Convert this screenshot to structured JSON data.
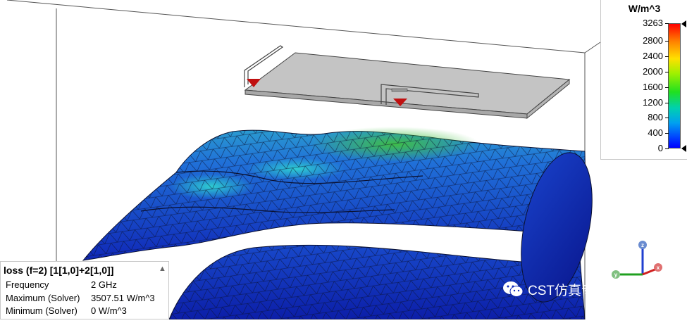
{
  "legend": {
    "unit": "W/m^3",
    "ticks": [
      "3263",
      "2800",
      "2400",
      "2000",
      "1600",
      "1200",
      "800",
      "400",
      "0"
    ],
    "max_value": 3263,
    "min_value": 0,
    "colors": [
      "#ff0000",
      "#ff8000",
      "#ffe000",
      "#a0f000",
      "#20e020",
      "#00d0b0",
      "#00a0f0",
      "#0040ff",
      "#0000ff"
    ]
  },
  "info": {
    "title": "loss (f=2) [1[1,0]+2[1,0]]",
    "rows": [
      {
        "label": "Frequency",
        "value": "2 GHz"
      },
      {
        "label": "Maximum (Solver)",
        "value": "3507.51 W/m^3"
      },
      {
        "label": "Minimum (Solver)",
        "value": "0 W/m^3"
      }
    ]
  },
  "axes": {
    "x": "x",
    "y": "y",
    "z": "z"
  },
  "watermark": {
    "text": "CST仿真专家之路",
    "icon": "wechat-icon"
  },
  "colors": {
    "mesh_blue": "#1530c8",
    "mesh_cyan": "#20a0d8",
    "mesh_green": "#3cc040",
    "antenna_gray": "#c4c4c4",
    "feed_red": "#c01010"
  }
}
